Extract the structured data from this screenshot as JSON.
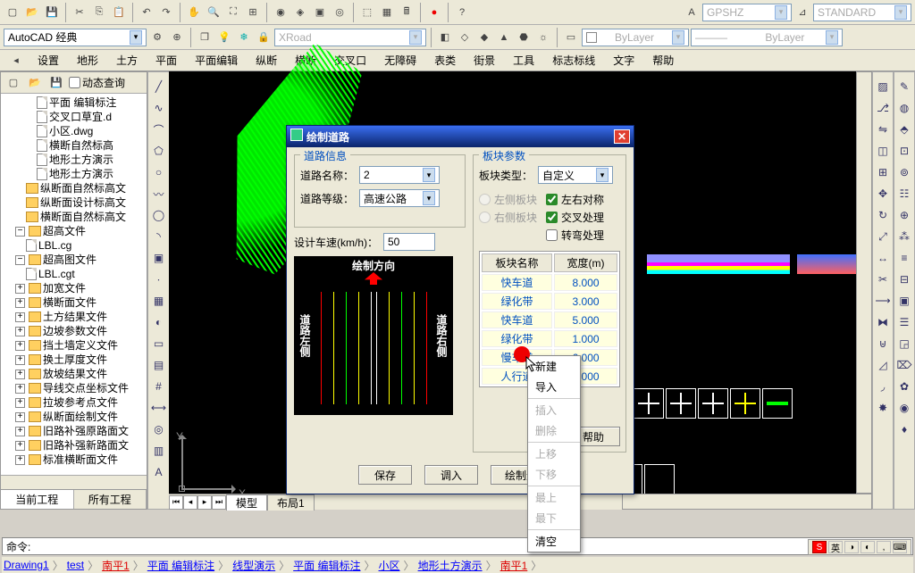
{
  "toolbar1": {
    "workspace": "AutoCAD 经典",
    "sxcombo": "XRoad",
    "layer": "ByLayer",
    "linetype": "ByLayer",
    "right1": "GPSHZ",
    "right2": "STANDARD"
  },
  "menus": [
    "设置",
    "地形",
    "土方",
    "平面",
    "平面编辑",
    "纵断",
    "横断",
    "交叉口",
    "无障碍",
    "表类",
    "街景",
    "工具",
    "标志标线",
    "文字",
    "帮助"
  ],
  "side": {
    "dynquery": "动态查询",
    "tree": [
      {
        "l": 3,
        "t": "d",
        "label": "平面 编辑标注"
      },
      {
        "l": 3,
        "t": "d",
        "label": "交叉口草宜.d"
      },
      {
        "l": 3,
        "t": "d",
        "label": "小区.dwg"
      },
      {
        "l": 3,
        "t": "d",
        "label": "横断自然标高"
      },
      {
        "l": 3,
        "t": "d",
        "label": "地形土方演示"
      },
      {
        "l": 3,
        "t": "d",
        "label": "地形土方演示"
      },
      {
        "l": 2,
        "t": "f",
        "label": "纵断面自然标高文"
      },
      {
        "l": 2,
        "t": "f",
        "label": "纵断面设计标高文"
      },
      {
        "l": 2,
        "t": "f",
        "label": "横断面自然标高文"
      },
      {
        "l": 1,
        "t": "f",
        "exp": "−",
        "label": "超高文件"
      },
      {
        "l": 2,
        "t": "d",
        "label": "LBL.cg"
      },
      {
        "l": 1,
        "t": "f",
        "exp": "−",
        "label": "超高图文件"
      },
      {
        "l": 2,
        "t": "d",
        "label": "LBL.cgt"
      },
      {
        "l": 1,
        "t": "f",
        "exp": "+",
        "label": "加宽文件"
      },
      {
        "l": 1,
        "t": "f",
        "exp": "+",
        "label": "横断面文件"
      },
      {
        "l": 1,
        "t": "f",
        "exp": "+",
        "label": "土方结果文件"
      },
      {
        "l": 1,
        "t": "f",
        "exp": "+",
        "label": "边坡参数文件"
      },
      {
        "l": 1,
        "t": "f",
        "exp": "+",
        "label": "挡土墙定义文件"
      },
      {
        "l": 1,
        "t": "f",
        "exp": "+",
        "label": "换土厚度文件"
      },
      {
        "l": 1,
        "t": "f",
        "exp": "+",
        "label": "放坡结果文件"
      },
      {
        "l": 1,
        "t": "f",
        "exp": "+",
        "label": "导线交点坐标文件"
      },
      {
        "l": 1,
        "t": "f",
        "exp": "+",
        "label": "拉坡参考点文件"
      },
      {
        "l": 1,
        "t": "f",
        "exp": "+",
        "label": "纵断面绘制文件"
      },
      {
        "l": 1,
        "t": "f",
        "exp": "+",
        "label": "旧路补强原路面文"
      },
      {
        "l": 1,
        "t": "f",
        "exp": "+",
        "label": "旧路补强新路面文"
      },
      {
        "l": 1,
        "t": "f",
        "exp": "+",
        "label": "标准横断面文件"
      }
    ],
    "tabs": [
      "当前工程",
      "所有工程"
    ]
  },
  "canvas_tabs": [
    "模型",
    "布局1"
  ],
  "axis": {
    "y": "Y",
    "x": "X"
  },
  "dialog": {
    "title": "绘制道路",
    "grp1": "道路信息",
    "road_name_lbl": "道路名称：",
    "road_name": "2",
    "road_grade_lbl": "道路等级：",
    "road_grade": "高速公路",
    "speed_lbl": "设计车速(km/h)：",
    "speed": "50",
    "preview_title": "绘制方向",
    "preview_left": "道路左侧",
    "preview_right": "道路右侧",
    "grp2": "板块参数",
    "block_type_lbl": "板块类型：",
    "block_type": "自定义",
    "chk_sym": "左右对称",
    "chk_cross": "交叉处理",
    "chk_turn": "转弯处理",
    "rad_left": "左侧板块",
    "rad_right": "右侧板块",
    "tbl_h1": "板块名称",
    "tbl_h2": "宽度(m)",
    "rows": [
      {
        "n": "快车道",
        "v": "8.000"
      },
      {
        "n": "绿化带",
        "v": "3.000"
      },
      {
        "n": "快车道",
        "v": "5.000"
      },
      {
        "n": "绿化带",
        "v": "1.000"
      },
      {
        "n": "慢车道",
        "v": "6.000"
      },
      {
        "n": "人行道",
        "v": "5.000"
      }
    ],
    "btns": {
      "save": "保存",
      "load": "调入",
      "draw": "绘制道路",
      "help": "帮助"
    }
  },
  "ctx": [
    "新建",
    "导入",
    "",
    "插入",
    "删除",
    "",
    "上移",
    "下移",
    "",
    "最上",
    "最下",
    "",
    "清空"
  ],
  "cmd": {
    "prompt": "命令:"
  },
  "doctabs": [
    "Drawing1",
    "test",
    "南平1",
    "平面 编辑标注",
    "线型演示",
    "平面 编辑标注",
    "小区",
    "地形土方演示",
    "南平1"
  ],
  "ime": [
    "S",
    "英",
    "◑",
    "◐",
    ",",
    "⌨"
  ]
}
